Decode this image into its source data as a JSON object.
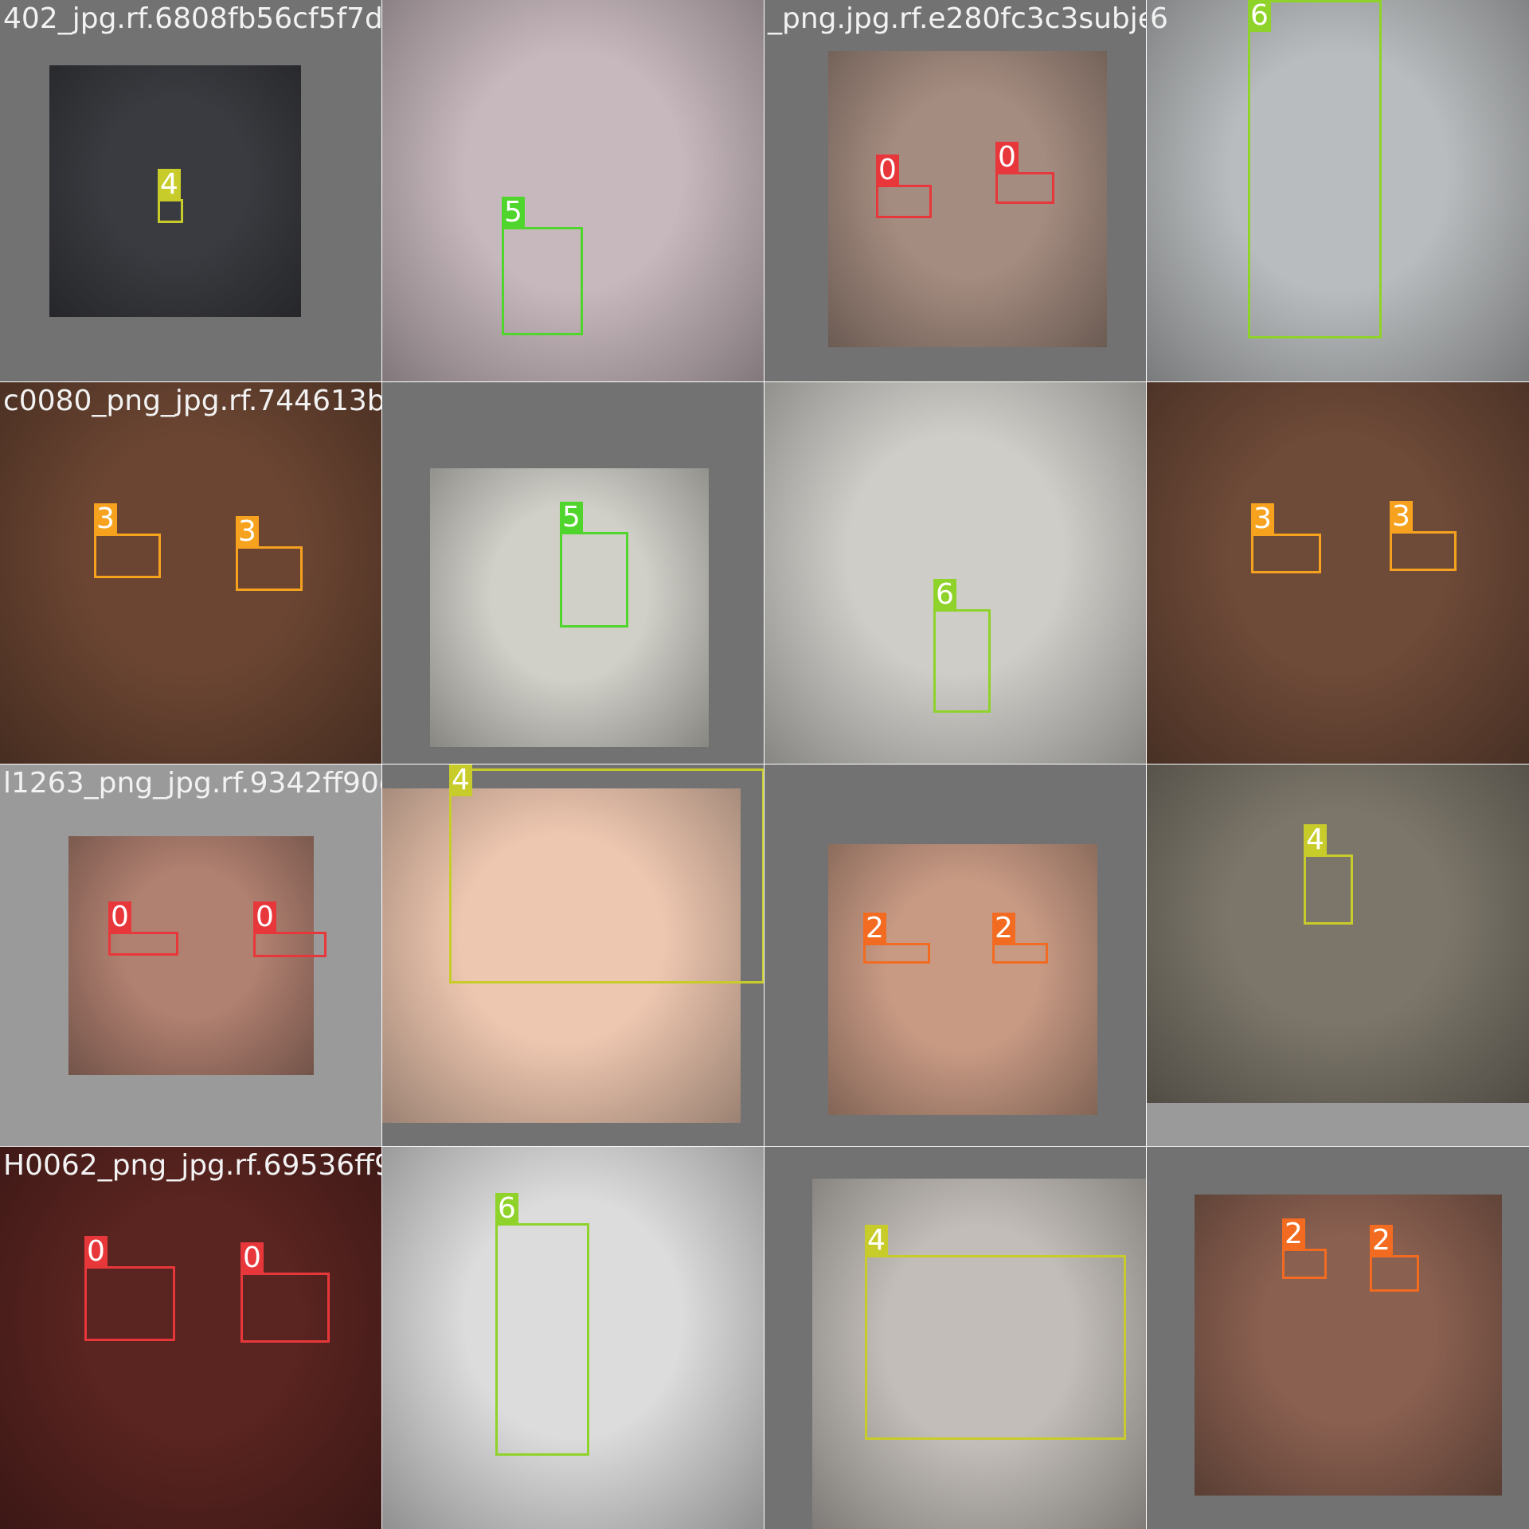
{
  "colors": {
    "0": "#e8373b",
    "2": "#f26b21",
    "3": "#f6a21e",
    "4": "#c8cc2a",
    "5": "#4fd52b",
    "6": "#8fd22a"
  },
  "tiles": [
    {
      "filename": "402_jpg.rf.6808fb56cf5f7d186f16a4303c5d7f.b2146fffc10f8072c2807e0",
      "frame": "dark",
      "scene": "#3a3b40",
      "boxes": [
        {
          "label": "4"
        }
      ]
    },
    {
      "filename": "",
      "frame": "none",
      "scene": "#c7b8bd",
      "boxes": [
        {
          "label": "5"
        }
      ]
    },
    {
      "filename": "_png.jpg.rf.e280fc3c3subject_9_b002qs",
      "frame": "dark",
      "scene": "#a58c80",
      "boxes": [
        {
          "label": "0"
        },
        {
          "label": "0"
        }
      ]
    },
    {
      "filename": "6",
      "frame": "none",
      "scene": "#b9bcbe",
      "boxes": [
        {
          "label": "6"
        }
      ]
    },
    {
      "filename": "c0080_png_jpg.rf.744613b4f99f64d2702_rgb_png_jpg.rf-257283574a604188c42fb65326756804af.rf.1d2d8a50",
      "frame": "none",
      "scene": "#6b4532",
      "boxes": [
        {
          "label": "3"
        },
        {
          "label": "3"
        }
      ]
    },
    {
      "filename": "",
      "frame": "dark",
      "scene": "#d0cfc8",
      "boxes": [
        {
          "label": "5"
        }
      ]
    },
    {
      "filename": "",
      "frame": "none",
      "scene": "#cfcdc8",
      "boxes": [
        {
          "label": "6"
        }
      ]
    },
    {
      "filename": "",
      "frame": "none",
      "scene": "#6e4a38",
      "boxes": [
        {
          "label": "3"
        },
        {
          "label": "3"
        }
      ]
    },
    {
      "filename": "l1263_png_jpg.rf.9342ff90c36fa39d04e7d07cd92fdc8cc90258_png_jpg.rf.5d6c2ab979af1813d8823fcf9680ecc",
      "frame": "light",
      "scene": "#b08070",
      "boxes": [
        {
          "label": "0"
        },
        {
          "label": "0"
        }
      ]
    },
    {
      "filename": "",
      "frame": "none",
      "scene": "#eec7b0",
      "boxes": [
        {
          "label": "4"
        }
      ]
    },
    {
      "filename": "",
      "frame": "dark",
      "scene": "#c89a84",
      "boxes": [
        {
          "label": "2"
        },
        {
          "label": "2"
        }
      ]
    },
    {
      "filename": "",
      "frame": "light",
      "scene": "#7c766a",
      "boxes": [
        {
          "label": "4"
        }
      ]
    },
    {
      "filename": "H0062_png_jpg.rf.69536ff95973f5c8f525bdcavjvqpr0_vid_18_frame0_jpg.60a80596df0e80a2epbg1jpg.f.57083a20",
      "frame": "none",
      "scene": "#5a2420",
      "boxes": [
        {
          "label": "0"
        },
        {
          "label": "0"
        }
      ]
    },
    {
      "filename": "",
      "frame": "none",
      "scene": "#dcdcdc",
      "boxes": [
        {
          "label": "6"
        }
      ]
    },
    {
      "filename": "",
      "frame": "dark",
      "scene": "#c2bdb8",
      "boxes": [
        {
          "label": "4"
        }
      ]
    },
    {
      "filename": "",
      "frame": "dark",
      "scene": "#8a6050",
      "boxes": [
        {
          "label": "2"
        },
        {
          "label": "2"
        }
      ]
    }
  ]
}
